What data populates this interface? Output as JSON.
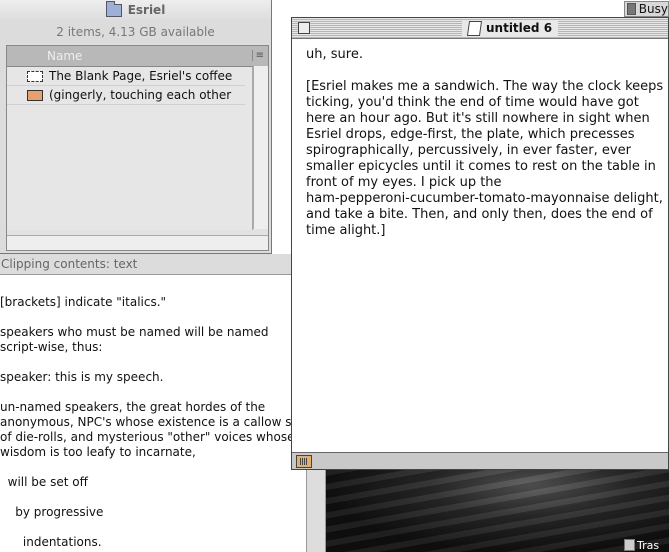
{
  "menubar": {
    "busy_label": "Busy"
  },
  "finder": {
    "title": "Esriel",
    "info": "2 items, 4.13 GB available",
    "column_name": "Name",
    "items": [
      {
        "label": "The Blank Page, Esriel's coffee",
        "icon": "text-clipping-icon"
      },
      {
        "label": "(gingerly, touching each other",
        "icon": "picture-clipping-icon"
      }
    ]
  },
  "clipping": {
    "header": "Clipping contents: text",
    "lines": [
      "[brackets] indicate \"italics.\"",
      "",
      "speakers who must be named will be named",
      "script-wise, thus:",
      "",
      "speaker: this is my speech.",
      "",
      "un-named speakers, the great hordes of the",
      "anonymous, NPC's whose existence is a callow set",
      "of die-rolls, and mysterious \"other\" voices whose",
      "wisdom is too leafy to incarnate,",
      "",
      "  will be set off",
      "",
      "    by progressive",
      "",
      "      indentations."
    ]
  },
  "document": {
    "title": "untitled 6",
    "paragraphs": [
      "uh, sure.",
      "[Esriel makes me a sandwich. The way the clock keeps\nticking, you'd think the end of time would have got\nhere an hour ago. But it's still nowhere in sight when\nEsriel drops, edge-first, the plate, which precesses\nspirographically, percussively, in ever faster, ever\nsmaller epicycles until it comes to rest on the table in\nfront of my eyes. I pick up the\nham-pepperoni-cucumber-tomato-mayonnaise delight,\nand take a bite. Then, and only then, does the end of\ntime alight.]"
    ]
  },
  "desktop": {
    "trash_label": "Tras"
  }
}
